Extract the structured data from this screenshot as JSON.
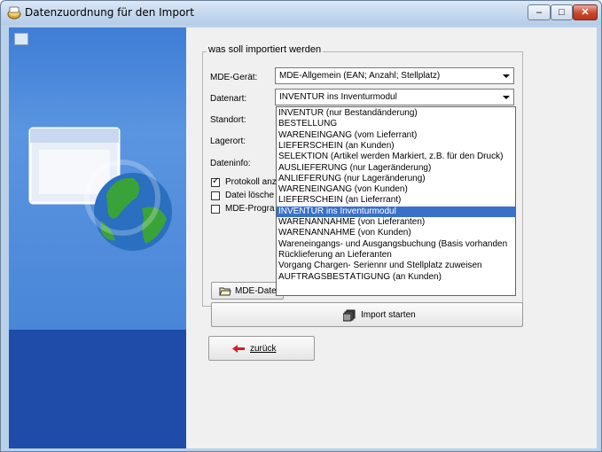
{
  "window": {
    "title": "Datenzuordnung für den Import"
  },
  "group": {
    "legend": "was soll importiert werden"
  },
  "form": {
    "mde_label": "MDE-Gerät:",
    "mde_value": "MDE-Allgemein (EAN; Anzahl; Stellplatz)",
    "datenart_label": "Datenart:",
    "datenart_value": "INVENTUR ins Inventurmodul",
    "standort_label": "Standort:",
    "lagerort_label": "Lagerort:",
    "dateninfo_label": "Dateninfo:",
    "protokoll_label": "Protokoll anz",
    "datei_loeschen_label": "Datei lösche",
    "mde_programm_label": "MDE-Progra",
    "mde_datei_button": "MDE-Date"
  },
  "dropdown_options": [
    "INVENTUR (nur Bestandänderung)",
    "BESTELLUNG",
    "WARENEINGANG (vom Lieferrant)",
    "LIEFERSCHEIN (an Kunden)",
    "SELEKTION (Artikel werden Markiert, z.B. für den Druck)",
    "AUSLIEFERUNG (nur Lageränderung)",
    "ANLIEFERUNG (nur Lageränderung)",
    "WARENEINGANG (von Kunden)",
    "LIEFERSCHEIN (an Lieferrant)",
    "INVENTUR ins Inventurmodul",
    "WARENANNAHME (von Lieferanten)",
    "WARENANNAHME (von Kunden)",
    "Wareneingangs- und Ausgangsbuchung (Basis vorhanden",
    "Rücklieferung an Lieferanten",
    "Vorgang Chargen- Seriennr und Stellplatz zuweisen",
    "AUFTRAGSBESTÄTIGUNG (an Kunden)"
  ],
  "selected_option_index": 9,
  "buttons": {
    "import_start": "Import starten",
    "back": "zurück"
  },
  "colors": {
    "selection": "#3a71c8",
    "panel_blue": "#1f4ca8"
  }
}
